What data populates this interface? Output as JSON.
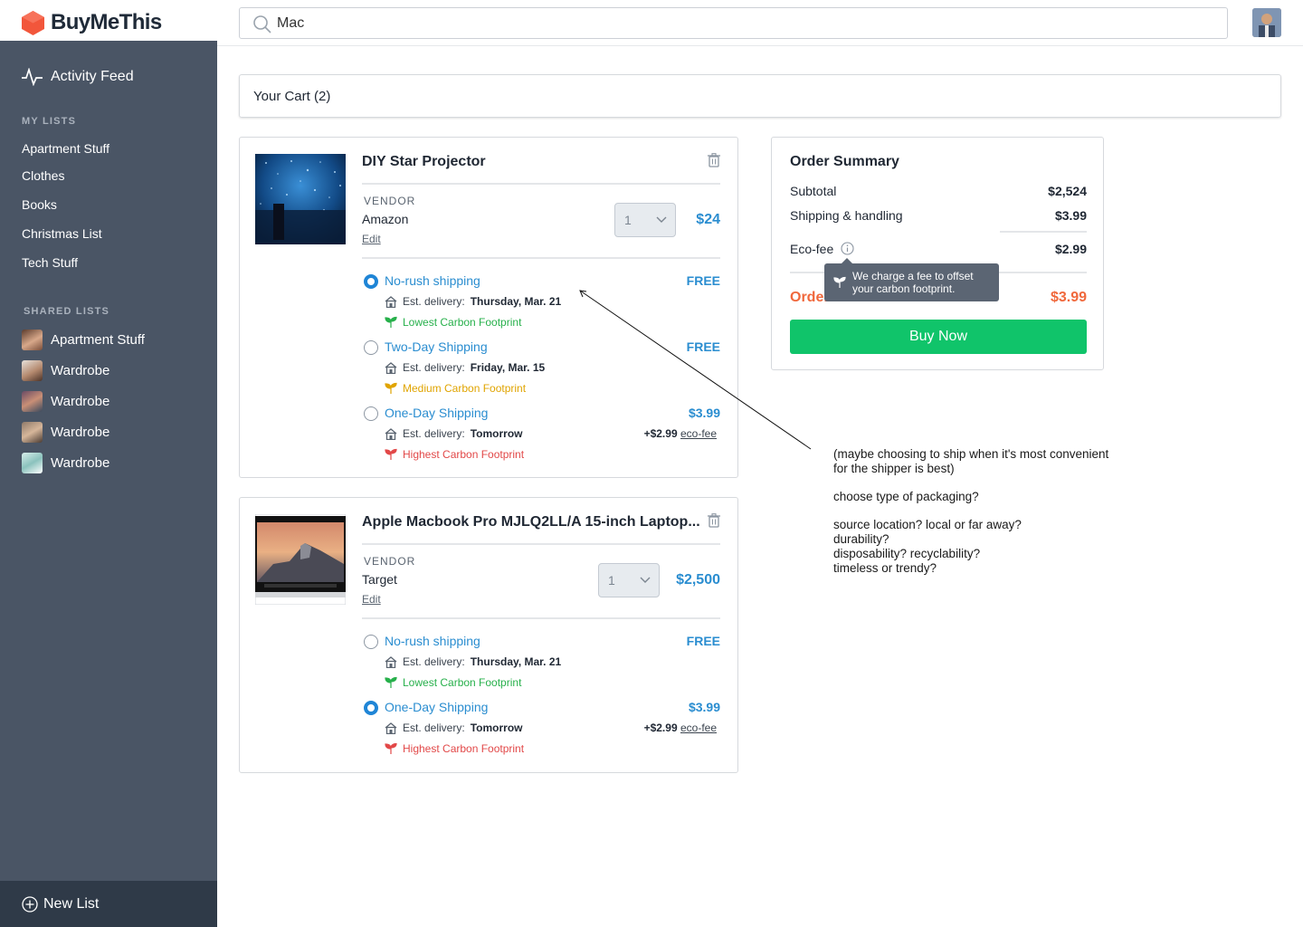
{
  "app": {
    "name": "BuyMeThis"
  },
  "search": {
    "value": "Mac"
  },
  "sidebar": {
    "activity_feed": "Activity Feed",
    "my_lists_heading": "MY LISTS",
    "my_lists": [
      "Apartment Stuff",
      "Clothes",
      "Books",
      "Christmas List",
      "Tech Stuff"
    ],
    "shared_lists_heading": "SHARED LISTS",
    "shared_lists": [
      "Apartment Stuff",
      "Wardrobe",
      "Wardrobe",
      "Wardrobe",
      "Wardrobe"
    ],
    "new_list": "New List"
  },
  "cart": {
    "title": "Your Cart (2)",
    "items": [
      {
        "title": "DIY Star Projector",
        "vendor_label": "VENDOR",
        "vendor": "Amazon",
        "edit": "Edit",
        "quantity": "1",
        "price": "$24",
        "shipping": [
          {
            "name": "No-rush shipping",
            "price": "FREE",
            "delivery_label": "Est. delivery:",
            "delivery": "Thursday, Mar. 21",
            "footprint": "Lowest Carbon Footprint",
            "selected": true
          },
          {
            "name": "Two-Day Shipping",
            "price": "FREE",
            "delivery_label": "Est. delivery:",
            "delivery": "Friday, Mar. 15",
            "footprint": "Medium Carbon Footprint",
            "selected": false
          },
          {
            "name": "One-Day Shipping",
            "price": "$3.99",
            "delivery_label": "Est. delivery:",
            "delivery": "Tomorrow",
            "footprint": "Highest Carbon Footprint",
            "eco_amount": "+$2.99",
            "eco_label": "eco-fee",
            "selected": false
          }
        ]
      },
      {
        "title": "Apple Macbook Pro MJLQ2LL/A 15-inch Laptop...",
        "vendor_label": "VENDOR",
        "vendor": "Target",
        "edit": "Edit",
        "quantity": "1",
        "price": "$2,500",
        "shipping": [
          {
            "name": "No-rush shipping",
            "price": "FREE",
            "delivery_label": "Est. delivery:",
            "delivery": "Thursday, Mar. 21",
            "footprint": "Lowest Carbon Footprint",
            "selected": false
          },
          {
            "name": "One-Day Shipping",
            "price": "$3.99",
            "delivery_label": "Est. delivery:",
            "delivery": "Tomorrow",
            "footprint": "Highest Carbon Footprint",
            "eco_amount": "+$2.99",
            "eco_label": "eco-fee",
            "selected": true
          }
        ]
      }
    ]
  },
  "summary": {
    "title": "Order Summary",
    "subtotal_label": "Subtotal",
    "subtotal": "$2,524",
    "shipping_label": "Shipping & handling",
    "shipping": "$3.99",
    "eco_label": "Eco-fee",
    "eco": "$2.99",
    "total_label": "Order total",
    "total": "$3.99",
    "buy": "Buy Now",
    "tooltip_line1": "We charge a fee to offset",
    "tooltip_line2": "your carbon footprint."
  },
  "notes": {
    "line1": "(maybe choosing to ship when it's most convenient",
    "line2": "for the shipper is best)",
    "line3": "choose type of packaging?",
    "line4": "source location? local or far away?",
    "line5": "durability?",
    "line6": "disposability? recyclability?",
    "line7": "timeless or trendy?"
  },
  "colors": {
    "accent": "#2a8dd0",
    "buy": "#10c46a",
    "total": "#f0683c",
    "sidebar": "#4a5565",
    "low": "#27b04b",
    "medium": "#e0a400",
    "high": "#e24848"
  }
}
